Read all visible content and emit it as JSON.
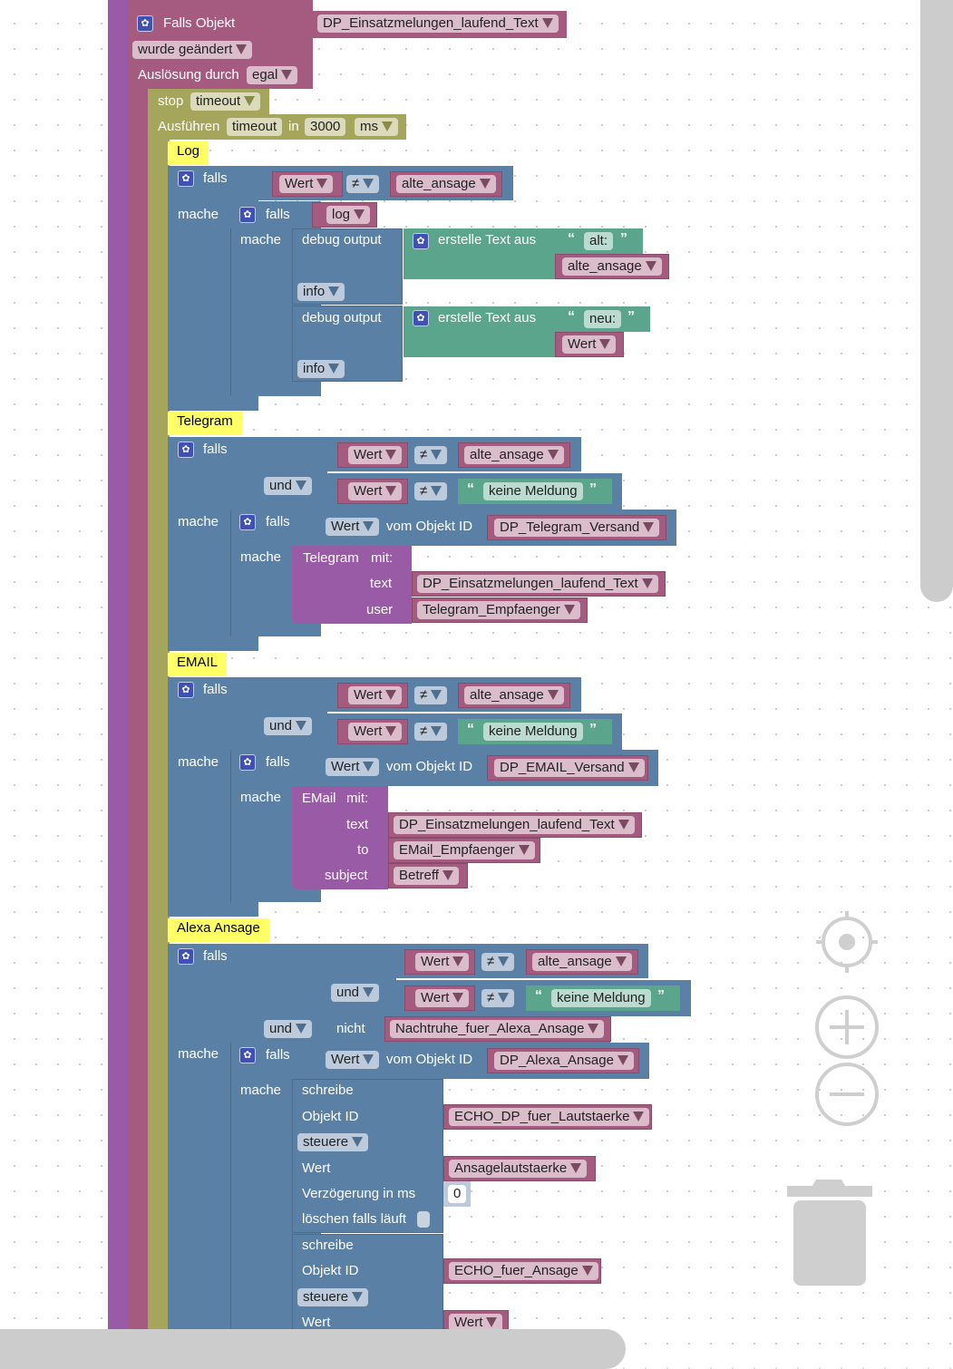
{
  "trigger": {
    "title": "Falls Objekt",
    "object": "DP_Einsatzmelungen_laufend_Text",
    "event": "wurde geändert",
    "cause_label": "Auslösung durch",
    "cause": "egal"
  },
  "stop": {
    "label": "stop",
    "name": "timeout"
  },
  "timeout": {
    "label": "Ausführen",
    "name": "timeout",
    "in": "in",
    "value": "3000",
    "unit": "ms"
  },
  "common": {
    "falls": "falls",
    "mache": "mache",
    "und": "und",
    "nicht": "nicht",
    "neq": "≠",
    "wert": "Wert",
    "alte_ansage": "alte_ansage",
    "keine_meldung": "keine Meldung",
    "vom_objekt_id": "vom Objekt ID",
    "open_quote": "“",
    "close_quote": "”"
  },
  "log": {
    "comment": "Log",
    "log_var": "log",
    "debug_label": "debug output",
    "text_join": "erstelle Text aus",
    "old_text": "alt:",
    "new_text": "neu:",
    "level": "info"
  },
  "telegram": {
    "comment": "Telegram",
    "dp": "DP_Telegram_Versand",
    "block_title": "Telegram",
    "mit": "mit:",
    "text_label": "text",
    "text_value": "DP_Einsatzmelungen_laufend_Text",
    "user_label": "user",
    "user_value": "Telegram_Empfaenger"
  },
  "email": {
    "comment": "EMAIL",
    "dp": "DP_EMAIL_Versand",
    "block_title": "EMail",
    "mit": "mit:",
    "text_label": "text",
    "text_value": "DP_Einsatzmelungen_laufend_Text",
    "to_label": "to",
    "to_value": "EMail_Empfaenger",
    "subject_label": "subject",
    "subject_value": "Betreff"
  },
  "alexa": {
    "comment": "Alexa Ansage",
    "nachtruhe": "Nachtruhe_fuer_Alexa_Ansage",
    "dp": "DP_Alexa_Ansage",
    "write1": {
      "title": "schreibe",
      "objekt_label": "Objekt ID",
      "objekt_value": "ECHO_DP_fuer_Lautstaerke",
      "mode": "steuere",
      "wert_label": "Wert",
      "wert_value": "Ansagelautstaerke",
      "delay_label": "Verzögerung in ms",
      "delay_value": "0",
      "clear_label": "löschen falls läuft"
    },
    "write2": {
      "title": "schreibe",
      "objekt_label": "Objekt ID",
      "objekt_value": "ECHO_fuer_Ansage",
      "mode": "steuere",
      "wert_label": "Wert",
      "wert_value": "Wert"
    }
  },
  "controls": {
    "recenter": "recenter-icon",
    "zoom_in": "zoom-in-icon",
    "zoom_out": "zoom-out-icon",
    "trash": "trash-icon"
  }
}
